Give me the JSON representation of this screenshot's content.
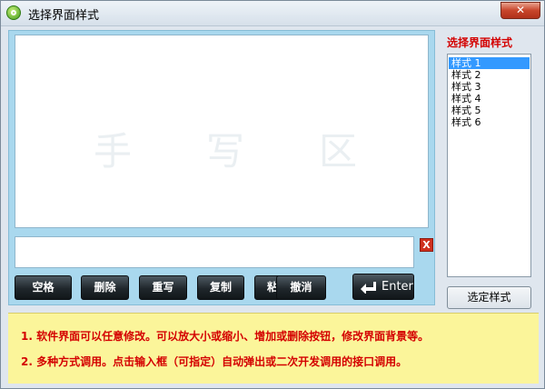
{
  "window": {
    "title": "选择界面样式",
    "close_label": "✕"
  },
  "handwriting": {
    "watermark_chars": [
      "手",
      "写",
      "区"
    ]
  },
  "input": {
    "value": "",
    "clear_label": "X"
  },
  "buttons": {
    "space": "空格",
    "delete": "删除",
    "rewrite": "重写",
    "copy": "复制",
    "paste": "粘贴",
    "undo": "撤消",
    "enter": "Enter"
  },
  "side": {
    "title": "选择界面样式",
    "styles": [
      "样式 1",
      "样式 2",
      "样式 3",
      "样式 4",
      "样式 5",
      "样式 6"
    ],
    "selected_index": 0,
    "select_button": "选定样式"
  },
  "info": {
    "line1": "1. 软件界面可以任意修改。可以放大小或缩小、增加或删除按钮，修改界面背景等。",
    "line2": "2. 多种方式调用。点击输入框（可指定）自动弹出或二次开发调用的接口调用。"
  },
  "colors": {
    "accent_red": "#d40000",
    "panel_blue": "#a9d8ee",
    "info_yellow": "#fbf59a",
    "list_selected": "#3399ff"
  }
}
